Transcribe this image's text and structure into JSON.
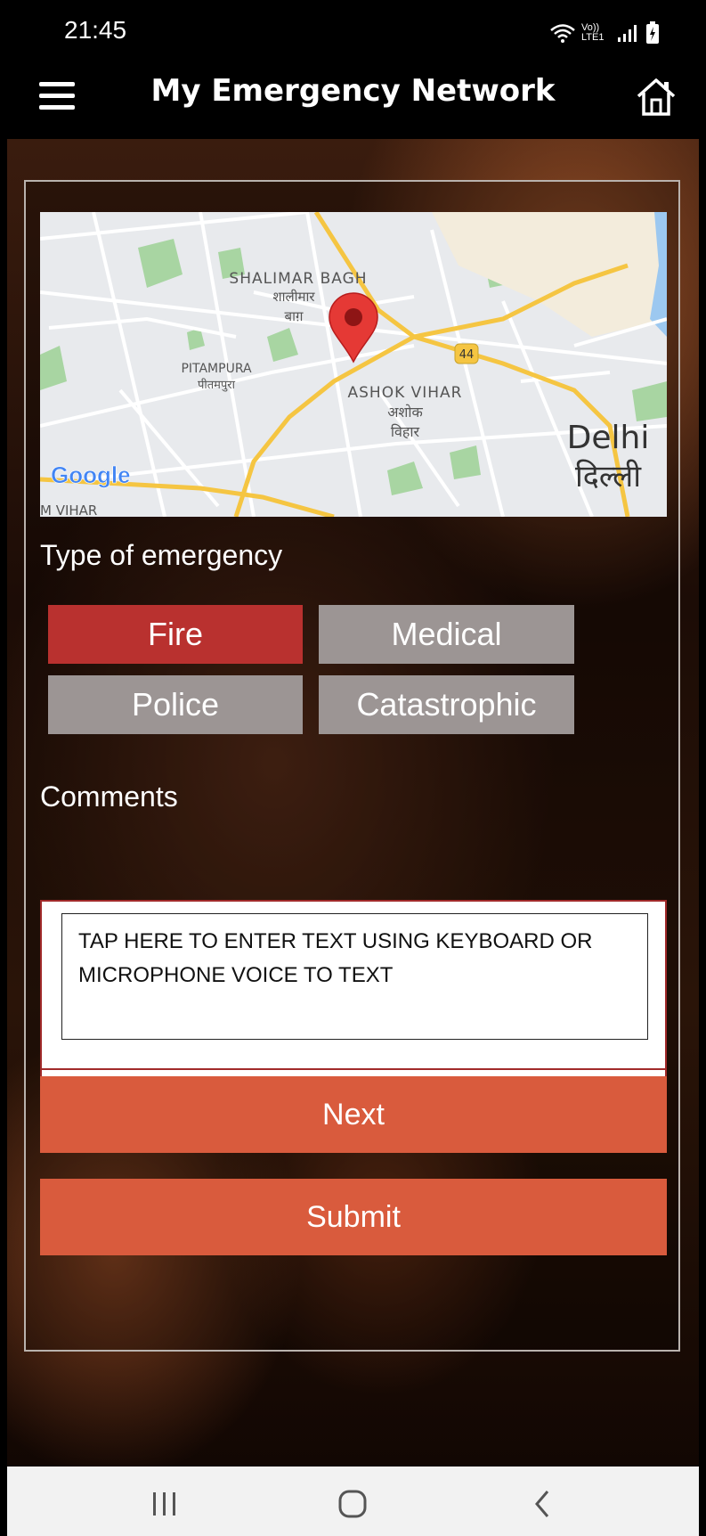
{
  "status_bar": {
    "time": "21:45",
    "network_label": "Vo)) LTE1"
  },
  "app_bar": {
    "title": "My Emergency Network"
  },
  "map": {
    "labels": {
      "shalimar_bagh": "SHALIMAR BAGH",
      "shalimar_bagh_hi": "शालीमार",
      "shalimar_bagh_hi2": "बाग़",
      "pitampura": "PITAMPURA",
      "pitampura_hi": "पीतमपुरा",
      "ashok_vihar": "ASHOK VIHAR",
      "ashok_vihar_hi": "अशोक",
      "ashok_vihar_hi2": "विहार",
      "delhi": "Delhi",
      "delhi_hi": "दिल्ली",
      "highway": "44",
      "bottom_left": "M VIHAR",
      "logo": "Google"
    }
  },
  "emergency": {
    "label": "Type of emergency",
    "types": [
      {
        "label": "Fire",
        "selected": true
      },
      {
        "label": "Medical",
        "selected": false
      },
      {
        "label": "Police",
        "selected": false
      },
      {
        "label": "Catastrophic",
        "selected": false
      }
    ]
  },
  "comments": {
    "label": "Comments",
    "placeholder": "TAP HERE TO ENTER TEXT USING KEYBOARD OR MICROPHONE VOICE TO TEXT"
  },
  "buttons": {
    "next": "Next",
    "submit": "Submit"
  },
  "colors": {
    "selected": "#b9312f",
    "unselected": "#9c9594",
    "action": "#d95b3d",
    "border": "#a12a2a"
  }
}
